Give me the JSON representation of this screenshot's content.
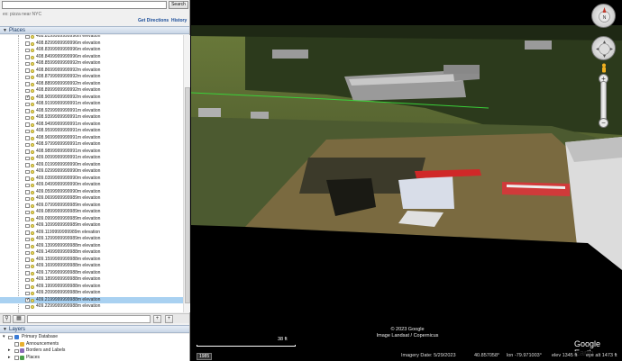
{
  "search": {
    "placeholder": "",
    "button": "Search",
    "hint": "ex: pizza near NYC",
    "get_directions": "Get Directions",
    "history": "History"
  },
  "places": {
    "header": "Places",
    "rows": [
      {
        "label": "408.8199999999996m elevation",
        "checked": false,
        "selected": false
      },
      {
        "label": "408.8299999999996m elevation",
        "checked": false,
        "selected": false
      },
      {
        "label": "408.8399999999996m elevation",
        "checked": false,
        "selected": false
      },
      {
        "label": "408.8499999999996m elevation",
        "checked": false,
        "selected": false
      },
      {
        "label": "408.8599999999992m elevation",
        "checked": false,
        "selected": false
      },
      {
        "label": "408.8699999999992m elevation",
        "checked": false,
        "selected": false
      },
      {
        "label": "408.8799999999992m elevation",
        "checked": false,
        "selected": false
      },
      {
        "label": "408.8899999999992m elevation",
        "checked": false,
        "selected": false
      },
      {
        "label": "408.8999999999992m elevation",
        "checked": false,
        "selected": false
      },
      {
        "label": "408.9099999999992m elevation",
        "checked": true,
        "selected": false
      },
      {
        "label": "408.9199999999991m elevation",
        "checked": false,
        "selected": false
      },
      {
        "label": "408.9299999999991m elevation",
        "checked": false,
        "selected": false
      },
      {
        "label": "408.9399999999991m elevation",
        "checked": false,
        "selected": false
      },
      {
        "label": "408.9499999999991m elevation",
        "checked": false,
        "selected": false
      },
      {
        "label": "408.9599999999991m elevation",
        "checked": false,
        "selected": false
      },
      {
        "label": "408.9699999999991m elevation",
        "checked": false,
        "selected": false
      },
      {
        "label": "408.9799999999991m elevation",
        "checked": false,
        "selected": false
      },
      {
        "label": "408.9899999999991m elevation",
        "checked": false,
        "selected": false
      },
      {
        "label": "409.0099999999991m elevation",
        "checked": false,
        "selected": false
      },
      {
        "label": "409.0199999999990m elevation",
        "checked": false,
        "selected": false
      },
      {
        "label": "409.0299999999990m elevation",
        "checked": false,
        "selected": false
      },
      {
        "label": "409.0399999999990m elevation",
        "checked": false,
        "selected": false
      },
      {
        "label": "409.0499999999990m elevation",
        "checked": false,
        "selected": false
      },
      {
        "label": "409.0599999999990m elevation",
        "checked": false,
        "selected": false
      },
      {
        "label": "409.0699999999989m elevation",
        "checked": false,
        "selected": false
      },
      {
        "label": "409.0799999999989m elevation",
        "checked": false,
        "selected": false
      },
      {
        "label": "409.0899999999989m elevation",
        "checked": false,
        "selected": false
      },
      {
        "label": "409.0999999999989m elevation",
        "checked": false,
        "selected": false
      },
      {
        "label": "409.1099999999989m elevation",
        "checked": false,
        "selected": false
      },
      {
        "label": "409.1199999999989m elevation",
        "checked": false,
        "selected": false
      },
      {
        "label": "409.1299999999989m elevation",
        "checked": false,
        "selected": false
      },
      {
        "label": "409.1399999999988m elevation",
        "checked": false,
        "selected": false
      },
      {
        "label": "409.1499999999988m elevation",
        "checked": false,
        "selected": false
      },
      {
        "label": "409.1599999999988m elevation",
        "checked": false,
        "selected": false
      },
      {
        "label": "409.1699999999988m elevation",
        "checked": false,
        "selected": false
      },
      {
        "label": "409.1799999999988m elevation",
        "checked": false,
        "selected": false
      },
      {
        "label": "409.1899999999988m elevation",
        "checked": false,
        "selected": false
      },
      {
        "label": "409.1999999999988m elevation",
        "checked": false,
        "selected": false
      },
      {
        "label": "409.2099999999988m elevation",
        "checked": false,
        "selected": false
      },
      {
        "label": "409.2199999999988m elevation",
        "checked": true,
        "selected": true
      },
      {
        "label": "409.2299999999988m elevation",
        "checked": false,
        "selected": false
      }
    ]
  },
  "layers": {
    "header": "Layers",
    "items": [
      {
        "label": "Primary Database"
      },
      {
        "label": "Announcements"
      },
      {
        "label": "Borders and Labels"
      },
      {
        "label": "Places"
      }
    ]
  },
  "map": {
    "copyright_line1": "© 2023 Google",
    "copyright_line2": "Image Landsat / Copernicus",
    "logo": "Google Earth",
    "scale_label": "38 ft",
    "year_badge": "1985"
  },
  "status": {
    "imagery_date": "Imagery Date: 5/29/2023",
    "lat": "40.857058°",
    "lon": "lon  -79.971003°",
    "elev": "elev  1345 ft",
    "eye_alt": "eye alt   1473 ft"
  },
  "colors": {
    "accent_link": "#1a4d99",
    "selection": "#a9d1f1",
    "sky": "#000000"
  }
}
